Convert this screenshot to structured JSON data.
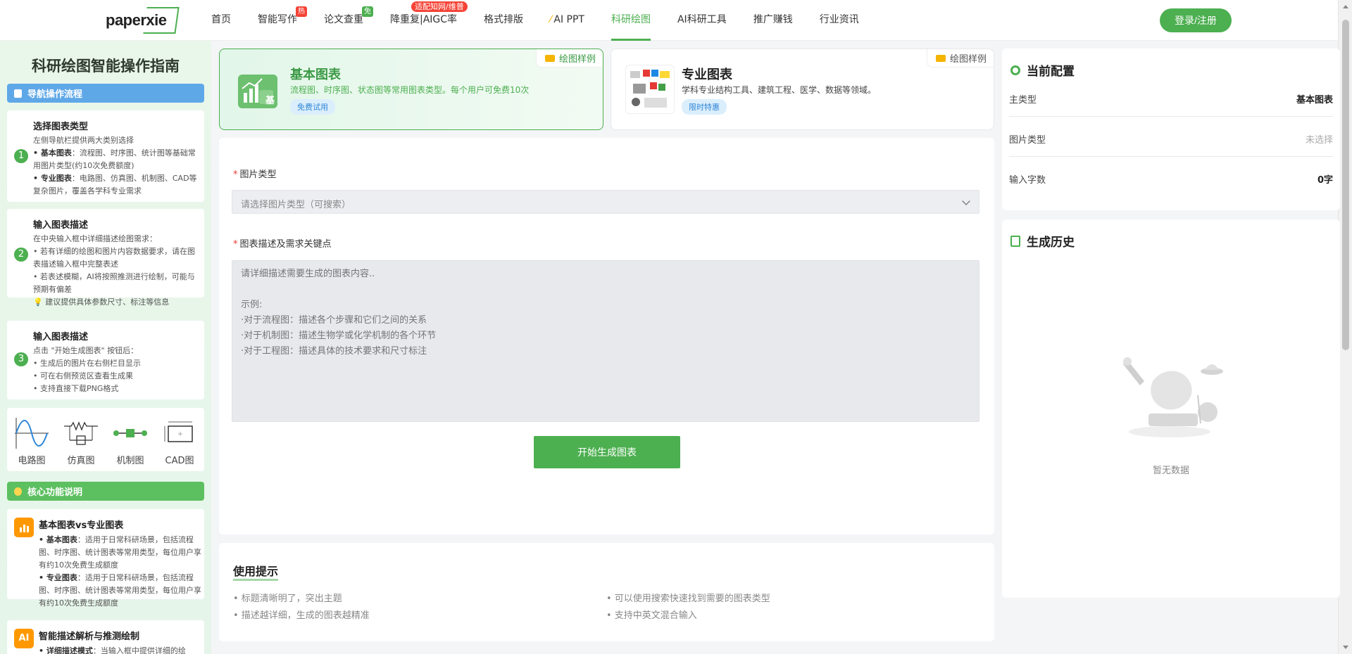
{
  "nav": {
    "logo": "paperxie",
    "items": [
      {
        "label": "首页",
        "badge": ""
      },
      {
        "label": "智能写作",
        "badge": "热"
      },
      {
        "label": "论文查重",
        "badge": "免"
      },
      {
        "label": "降重复|AIGC率",
        "badge": "适配知网/维普"
      },
      {
        "label": "格式排版",
        "badge": ""
      },
      {
        "label": "AI PPT",
        "badge": ""
      },
      {
        "label": "科研绘图",
        "badge": ""
      },
      {
        "label": "AI科研工具",
        "badge": ""
      },
      {
        "label": "推广赚钱",
        "badge": ""
      },
      {
        "label": "行业资讯",
        "badge": ""
      }
    ],
    "login": "登录/注册"
  },
  "sidebar": {
    "title": "科研绘图智能操作指南",
    "guide_head": "导航操作流程",
    "steps": [
      {
        "num": "1",
        "title": "选择图表类型",
        "lines": [
          {
            "text": "左侧导航栏提供两大类别选择",
            "bold": ""
          },
          {
            "text": "：流程图、时序图、统计图等基础常用图片类型(约10次免费额度)",
            "bold": "• 基本图表"
          },
          {
            "text": "：电路图、仿真图、机制图、CAD等复杂图片，覆盖各学科专业需求",
            "bold": "• 专业图表"
          }
        ]
      },
      {
        "num": "2",
        "title": "输入图表描述",
        "lines": [
          {
            "text": "在中央输入框中详细描述绘图需求：",
            "bold": ""
          },
          {
            "text": "• 若有详细的绘图和图片内容数据要求，请在图表描述输入框中完整表述",
            "bold": ""
          },
          {
            "text": "• 若表述模糊，AI将按照推测进行绘制，可能与预期有偏差",
            "bold": ""
          },
          {
            "text": "💡 建议提供具体参数尺寸、标注等信息",
            "bold": ""
          }
        ]
      },
      {
        "num": "3",
        "title": "输入图表描述",
        "lines": [
          {
            "text": "点击 \"开始生成图表\" 按钮后：",
            "bold": ""
          },
          {
            "text": "• 生成后的图片在右侧栏目显示",
            "bold": ""
          },
          {
            "text": "• 可在右侧预览区查看生成果",
            "bold": ""
          },
          {
            "text": "• 支持直接下载PNG格式",
            "bold": ""
          }
        ]
      }
    ],
    "icons": [
      {
        "label": "电路图",
        "icon": "sine-wave-icon"
      },
      {
        "label": "仿真图",
        "icon": "resistor-icon"
      },
      {
        "label": "机制图",
        "icon": "mechanism-icon"
      },
      {
        "label": "CAD图",
        "icon": "cad-icon"
      }
    ],
    "core_head": "核心功能说明",
    "features": [
      {
        "icon": "bar-chart-icon",
        "icon_text": "",
        "title": "基本图表vs专业图表",
        "lines": [
          {
            "bold": "• 基本图表",
            "text": "：适用于日常科研场景，包括流程图、时序图、统计图表等常用类型，每位用户享有约10次免费生成额度"
          },
          {
            "bold": "• 专业图表",
            "text": "：适用于日常科研场景，包括流程图、时序图、统计图表等常用类型，每位用户享有约10次免费生成额度"
          }
        ]
      },
      {
        "icon": "ai-icon",
        "icon_text": "AI",
        "title": "智能描述解析与推测绘制",
        "lines": [
          {
            "bold": "• 详细描述模式",
            "text": "：当输入框中提供详细的绘"
          }
        ]
      }
    ]
  },
  "chart_types": [
    {
      "title": "基本图表",
      "desc": "流程图、时序图、状态图等常用图表类型。每个用户可免费10次",
      "tag": "免费试用",
      "sample": "绘图样例",
      "icon_text": "基"
    },
    {
      "title": "专业图表",
      "desc": "学科专业结构工具、建筑工程、医学、数据等领域。",
      "tag": "限时特惠",
      "sample": "绘图样例"
    }
  ],
  "form": {
    "type_label": "图片类型",
    "type_placeholder": "请选择图片类型（可搜索）",
    "desc_label": "图表描述及需求关键点",
    "desc_placeholder": "请详细描述需要生成的图表内容..\n\n示例:\n·对于流程图：描述各个步骤和它们之间的关系\n·对于机制图：描述生物学或化学机制的各个环节\n·对于工程图：描述具体的技术要求和尺寸标注",
    "submit": "开始生成图表"
  },
  "tips": {
    "title": "使用提示",
    "items": [
      "• 标题清晰明了，突出主题",
      "• 可以使用搜索快速找到需要的图表类型",
      "• 描述越详细，生成的图表越精准",
      "• 支持中英文混合输入"
    ]
  },
  "config": {
    "title": "当前配置",
    "rows": [
      {
        "key": "主类型",
        "value": "基本图表"
      },
      {
        "key": "图片类型",
        "value": "未选择"
      },
      {
        "key": "输入字数",
        "value": "0字"
      }
    ]
  },
  "history": {
    "title": "生成历史",
    "empty": "暂无数据"
  },
  "colors": {
    "accent": "#4caf50",
    "blue": "#5fa8e8",
    "orange": "#ff9800"
  }
}
